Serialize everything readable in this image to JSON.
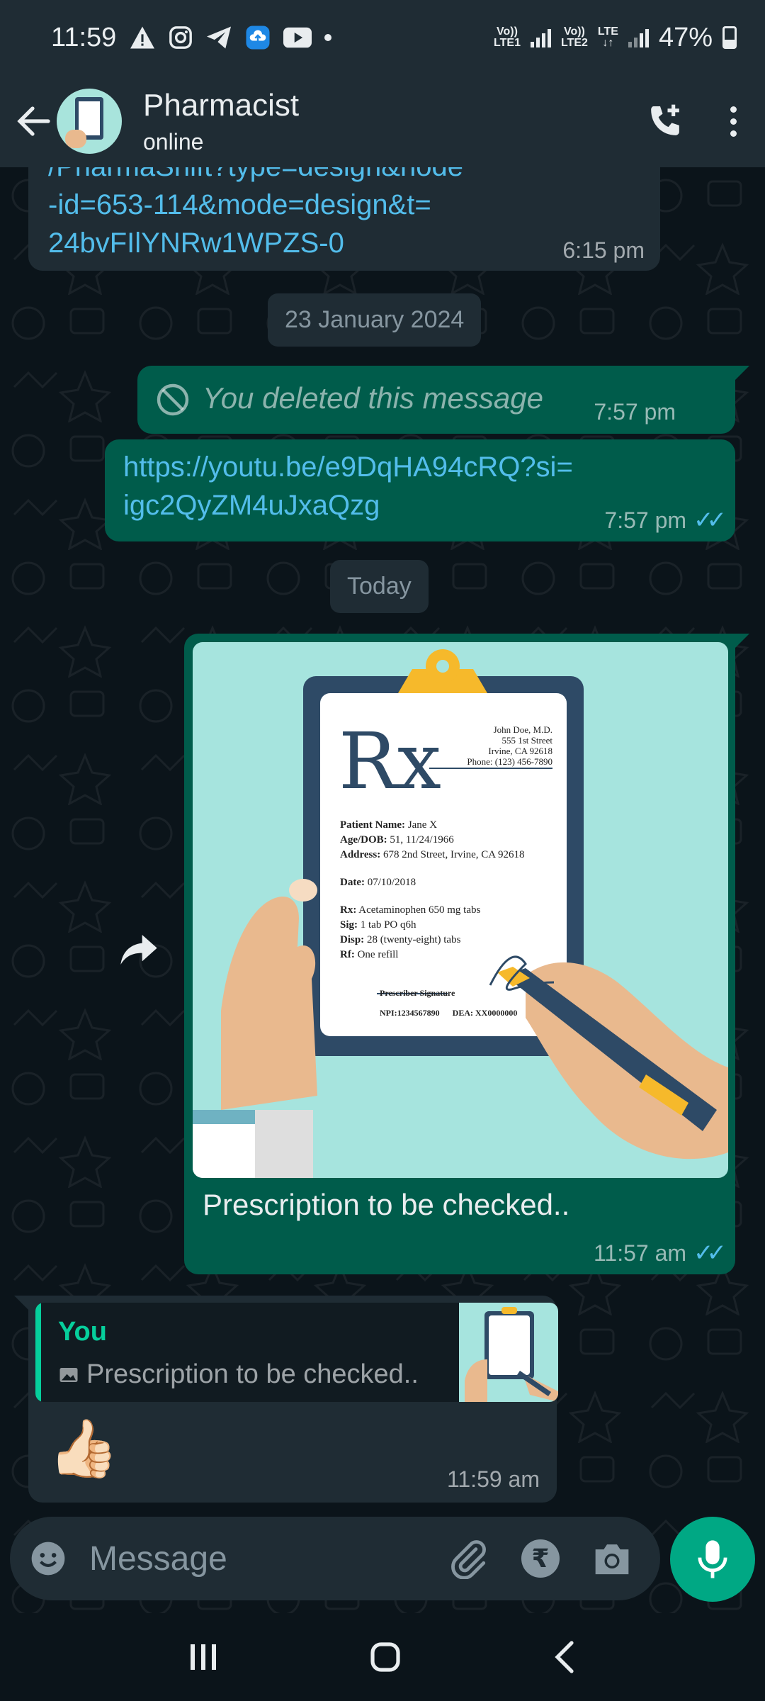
{
  "status_bar": {
    "time": "11:59",
    "sim1_top": "Vo))",
    "sim1_bottom": "LTE1",
    "sim2_top": "Vo))",
    "sim2_bottom": "LTE2",
    "network": "LTE",
    "battery": "47%"
  },
  "header": {
    "contact_name": "Pharmacist",
    "contact_status": "online"
  },
  "messages": {
    "m1": {
      "link_lines": [
        "/PharmaShift?type=design&node",
        "-id=653-114&mode=design&t=",
        "24bvFIlYNRw1WPZS-0"
      ],
      "time": "6:15 pm"
    },
    "date_1": "23 January 2024",
    "m2": {
      "text": "You deleted this message",
      "time": "7:57 pm"
    },
    "m3": {
      "link_lines": [
        "https://youtu.be/e9DqHA94cRQ?si=",
        "igc2QyZM4uJxaQzg"
      ],
      "time": "7:57 pm"
    },
    "date_2": "Today",
    "m4": {
      "caption": "Prescription to be checked..",
      "time": "11:57 am",
      "rx": {
        "symbol": "Rx",
        "doctor": "John Doe, M.D.",
        "street": "555 1st Street",
        "city": "Irvine, CA 92618",
        "phone": "Phone: (123) 456-7890",
        "patient_label": "Patient Name:",
        "patient": "Jane X",
        "age_label": "Age/DOB:",
        "age": "51, 11/24/1966",
        "address_label": "Address:",
        "address": "678 2nd Street, Irvine, CA 92618",
        "date_label": "Date:",
        "date": "07/10/2018",
        "rx_label": "Rx:",
        "rx_drug": "Acetaminophen 650 mg tabs",
        "sig_label": "Sig:",
        "sig": "1 tab PO q6h",
        "disp_label": "Disp:",
        "disp": "28 (twenty-eight) tabs",
        "rf_label": "Rf:",
        "rf": "One refill",
        "signature_label": "Prescriber Signature",
        "npi": "NPI:1234567890",
        "dea": "DEA: XX0000000"
      }
    },
    "m5": {
      "reply_author": "You",
      "reply_text": "Prescription to be checked..",
      "emoji": "👍🏻",
      "time": "11:59 am"
    }
  },
  "composer": {
    "placeholder": "Message"
  },
  "colors": {
    "outgoing": "#005c4b",
    "incoming": "#1f2c34",
    "accent": "#00a884",
    "link": "#53bdeb"
  }
}
